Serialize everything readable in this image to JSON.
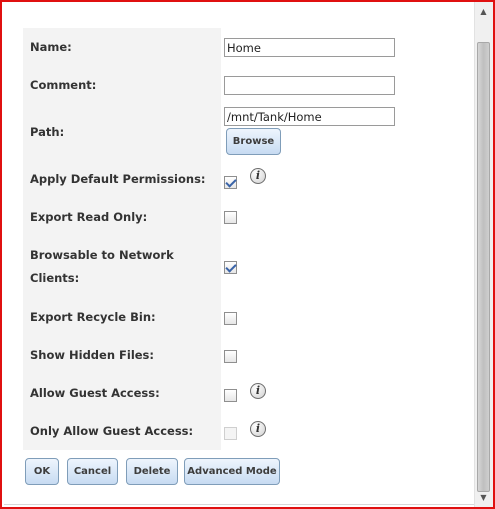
{
  "form": {
    "name": {
      "label": "Name:",
      "value": "Home"
    },
    "comment": {
      "label": "Comment:",
      "value": ""
    },
    "path": {
      "label": "Path:",
      "value": "/mnt/Tank/Home",
      "browse_label": "Browse"
    },
    "apply_default_permissions": {
      "label": "Apply Default Permissions:",
      "checked": true,
      "has_info": true
    },
    "export_read_only": {
      "label": "Export Read Only:",
      "checked": false
    },
    "browsable": {
      "label": "Browsable to Network Clients:",
      "checked": true
    },
    "export_recycle_bin": {
      "label": "Export Recycle Bin:",
      "checked": false
    },
    "show_hidden_files": {
      "label": "Show Hidden Files:",
      "checked": false
    },
    "allow_guest_access": {
      "label": "Allow Guest Access:",
      "checked": false,
      "has_info": true
    },
    "only_allow_guest_access": {
      "label": "Only Allow Guest Access:",
      "checked": false,
      "disabled": true,
      "has_info": true
    }
  },
  "buttons": {
    "ok": "OK",
    "cancel": "Cancel",
    "delete": "Delete",
    "advanced_mode": "Advanced Mode"
  },
  "info_icon_glyph": "i",
  "colors": {
    "frame_border": "#e01010",
    "label_bg": "#f3f3f3",
    "button_bg": "#c7dbf2"
  }
}
